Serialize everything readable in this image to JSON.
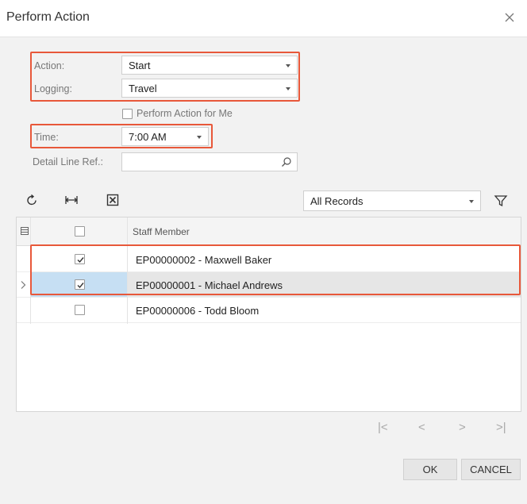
{
  "dialog": {
    "title": "Perform Action"
  },
  "form": {
    "action_label": "Action:",
    "action_value": "Start",
    "logging_label": "Logging:",
    "logging_value": "Travel",
    "perform_for_me_label": "Perform Action for Me",
    "perform_for_me_checked": false,
    "time_label": "Time:",
    "time_value": "7:00 AM",
    "detail_line_label": "Detail Line Ref.:",
    "detail_line_value": ""
  },
  "toolbar": {
    "icons": [
      "refresh-icon",
      "fit-columns-icon",
      "export-excel-icon",
      "filter-icon"
    ],
    "filter_value": "All Records"
  },
  "grid": {
    "columns": [
      "",
      "",
      "Staff Member"
    ],
    "rows": [
      {
        "checked": true,
        "staff_member": "EP00000002 - Maxwell Baker",
        "selected": false
      },
      {
        "checked": true,
        "staff_member": "EP00000001 - Michael Andrews",
        "selected": true
      },
      {
        "checked": false,
        "staff_member": "EP00000006 - Todd Bloom",
        "selected": false
      }
    ]
  },
  "pager": {
    "first": "|<",
    "prev": "<",
    "next": ">",
    "last": ">|"
  },
  "buttons": {
    "ok": "OK",
    "cancel": "CANCEL"
  },
  "colors": {
    "highlight": "#e8583a",
    "selected_cell": "#c6dff3",
    "selected_row": "#e6e6e6"
  }
}
